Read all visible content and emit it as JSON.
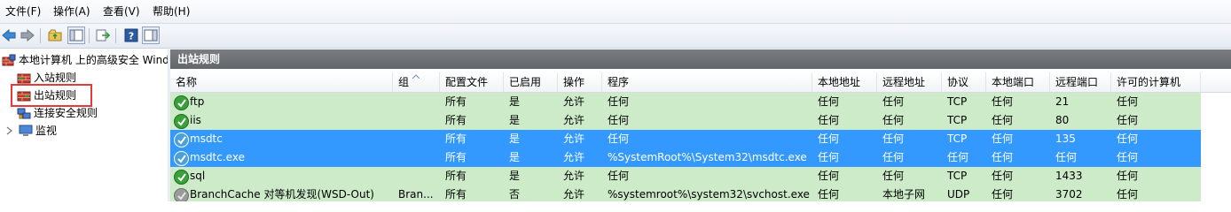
{
  "menu": [
    "文件(F)",
    "操作(A)",
    "查看(V)",
    "帮助(H)"
  ],
  "tree": {
    "root": "本地计算机 上的高级安全 Wind",
    "inbound": "入站规则",
    "outbound": "出站规则",
    "connection": "连接安全规则",
    "monitor": "监视"
  },
  "pane_title": "出站规则",
  "columns": [
    "名称",
    "组",
    "配置文件",
    "已启用",
    "操作",
    "程序",
    "本地地址",
    "远程地址",
    "协议",
    "本地端口",
    "远程端口",
    "许可的计算机"
  ],
  "rows": [
    {
      "name": "ftp",
      "group": "",
      "profile": "所有",
      "enabled": "是",
      "action": "允许",
      "program": "任何",
      "local_addr": "任何",
      "remote_addr": "任何",
      "protocol": "TCP",
      "local_port": "任何",
      "remote_port": "21",
      "computers": "任何",
      "state": "enabled"
    },
    {
      "name": "iis",
      "group": "",
      "profile": "所有",
      "enabled": "是",
      "action": "允许",
      "program": "任何",
      "local_addr": "任何",
      "remote_addr": "任何",
      "protocol": "TCP",
      "local_port": "任何",
      "remote_port": "80",
      "computers": "任何",
      "state": "enabled"
    },
    {
      "name": "msdtc",
      "group": "",
      "profile": "所有",
      "enabled": "是",
      "action": "允许",
      "program": "任何",
      "local_addr": "任何",
      "remote_addr": "任何",
      "protocol": "TCP",
      "local_port": "任何",
      "remote_port": "135",
      "computers": "任何",
      "state": "selected"
    },
    {
      "name": "msdtc.exe",
      "group": "",
      "profile": "所有",
      "enabled": "是",
      "action": "允许",
      "program": "%SystemRoot%\\System32\\msdtc.exe",
      "local_addr": "任何",
      "remote_addr": "任何",
      "protocol": "任何",
      "local_port": "任何",
      "remote_port": "任何",
      "computers": "任何",
      "state": "selected"
    },
    {
      "name": "sql",
      "group": "",
      "profile": "所有",
      "enabled": "是",
      "action": "允许",
      "program": "任何",
      "local_addr": "任何",
      "remote_addr": "任何",
      "protocol": "TCP",
      "local_port": "任何",
      "remote_port": "1433",
      "computers": "任何",
      "state": "enabled"
    },
    {
      "name": "BranchCache 对等机发现(WSD-Out)",
      "group": "Bran...",
      "profile": "所有",
      "enabled": "否",
      "action": "允许",
      "program": "%systemroot%\\system32\\svchost.exe",
      "local_addr": "任何",
      "remote_addr": "本地子网",
      "protocol": "UDP",
      "local_port": "任何",
      "remote_port": "3702",
      "computers": "任何",
      "state": "disabled"
    }
  ],
  "colors": {
    "rule_bg": "#cdebc9",
    "selected_bg": "#3399ff",
    "pane_header": "#6e7176",
    "highlight_box": "#e23b3b"
  }
}
